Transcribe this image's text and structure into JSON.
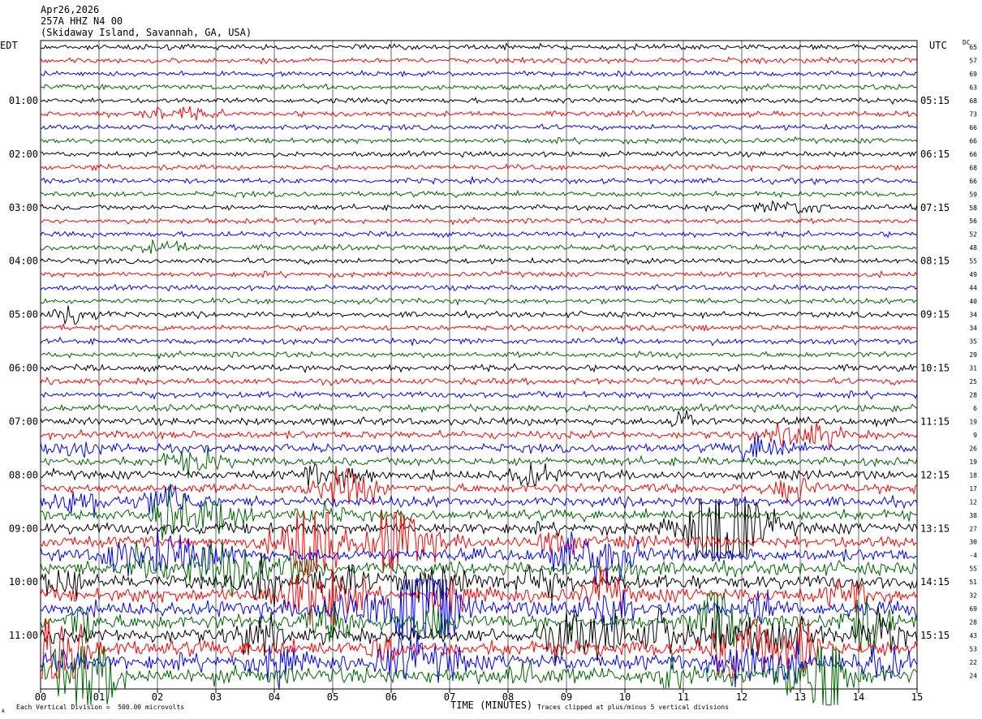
{
  "header": {
    "date": "Apr26,2026",
    "station": "257A HHZ N4 00",
    "location": "(Skidaway Island, Savannah, GA, USA)"
  },
  "left_tz": "EDT",
  "right_tz": "UTC",
  "dc_label": "DC",
  "footer": {
    "scale_note": "Each Vertical Division =  500.00 microvolts",
    "clip_note": "Traces clipped at plus/minus 5 vertical divisions",
    "corner_mark": "A"
  },
  "colors": {
    "trace_cycle": [
      "#000000",
      "#ff0000",
      "#0000ff",
      "#006400"
    ],
    "grid": "#000000",
    "background": "#ffffff"
  },
  "chart_data": {
    "type": "line",
    "title": "",
    "xlabel": "TIME (MINUTES)",
    "ylabel": "",
    "xlim": [
      0,
      15
    ],
    "x_ticks": [
      "00",
      "01",
      "02",
      "03",
      "04",
      "05",
      "06",
      "07",
      "08",
      "09",
      "10",
      "11",
      "12",
      "13",
      "14",
      "15"
    ],
    "grid": "vertical lines every minute",
    "left_hour_labels": [
      "01:00",
      "02:00",
      "03:00",
      "04:00",
      "05:00",
      "06:00",
      "07:00",
      "08:00",
      "09:00",
      "10:00",
      "11:00"
    ],
    "right_hour_labels": [
      "05:15",
      "06:15",
      "07:15",
      "08:15",
      "09:15",
      "10:15",
      "11:15",
      "12:15",
      "13:15",
      "14:15",
      "15:15"
    ],
    "rows": 48,
    "dc_offsets": [
      65,
      57,
      69,
      63,
      68,
      73,
      66,
      66,
      66,
      68,
      66,
      59,
      58,
      56,
      52,
      48,
      55,
      49,
      44,
      40,
      34,
      34,
      35,
      29,
      31,
      25,
      28,
      6,
      19,
      9,
      26,
      19,
      18,
      17,
      12,
      38,
      27,
      30,
      -4,
      55,
      51,
      32,
      69,
      28,
      43,
      53,
      22,
      24
    ],
    "activity_note": "Relative noise amplitude per row, increasing through the morning",
    "row_activity": [
      1,
      1,
      1,
      1,
      1,
      1,
      1,
      1,
      1,
      1,
      1,
      1,
      1,
      1,
      1,
      1,
      1,
      1,
      1,
      1,
      1.1,
      1.1,
      1.1,
      1.1,
      1.2,
      1.2,
      1.2,
      1.3,
      1.4,
      1.5,
      1.6,
      1.6,
      1.7,
      1.8,
      1.9,
      2.0,
      2.2,
      2.4,
      2.5,
      2.6,
      2.7,
      2.8,
      2.9,
      2.9,
      3.0,
      3.0,
      3.1,
      3.2
    ]
  }
}
